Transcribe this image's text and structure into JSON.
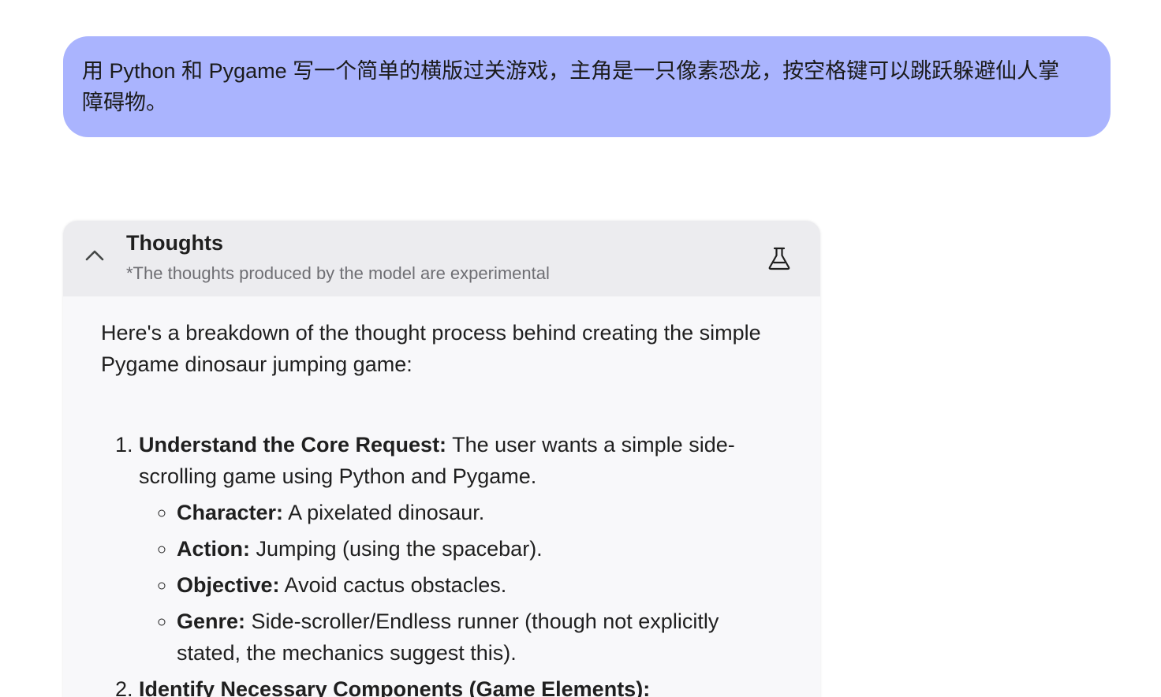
{
  "user_message": "用 Python 和 Pygame 写一个简单的横版过关游戏，主角是一只像素恐龙，按空格键可以跳跃躲避仙人掌障碍物。",
  "thoughts": {
    "title": "Thoughts",
    "subtitle": "*The thoughts produced by the model are experimental",
    "toggle_icon": "chevron-up-icon",
    "badge_icon": "flask-icon",
    "intro": "Here's a breakdown of the thought process behind creating the simple Pygame dinosaur jumping game:",
    "steps": [
      {
        "title": "Understand the Core Request:",
        "text": " The user wants a simple side-scrolling game using Python and Pygame.",
        "details": [
          {
            "label": "Character:",
            "text": " A pixelated dinosaur."
          },
          {
            "label": "Action:",
            "text": " Jumping (using the spacebar)."
          },
          {
            "label": "Objective:",
            "text": " Avoid cactus obstacles."
          },
          {
            "label": "Genre:",
            "text": " Side-scroller/Endless runner (though not explicitly stated, the mechanics suggest this)."
          }
        ]
      },
      {
        "title": "Identify Necessary Components (Game Elements):",
        "text": ""
      }
    ]
  },
  "colors": {
    "user_bubble": "#aab4fe",
    "thoughts_header": "#ececef",
    "thoughts_body": "#f8f8fa"
  }
}
